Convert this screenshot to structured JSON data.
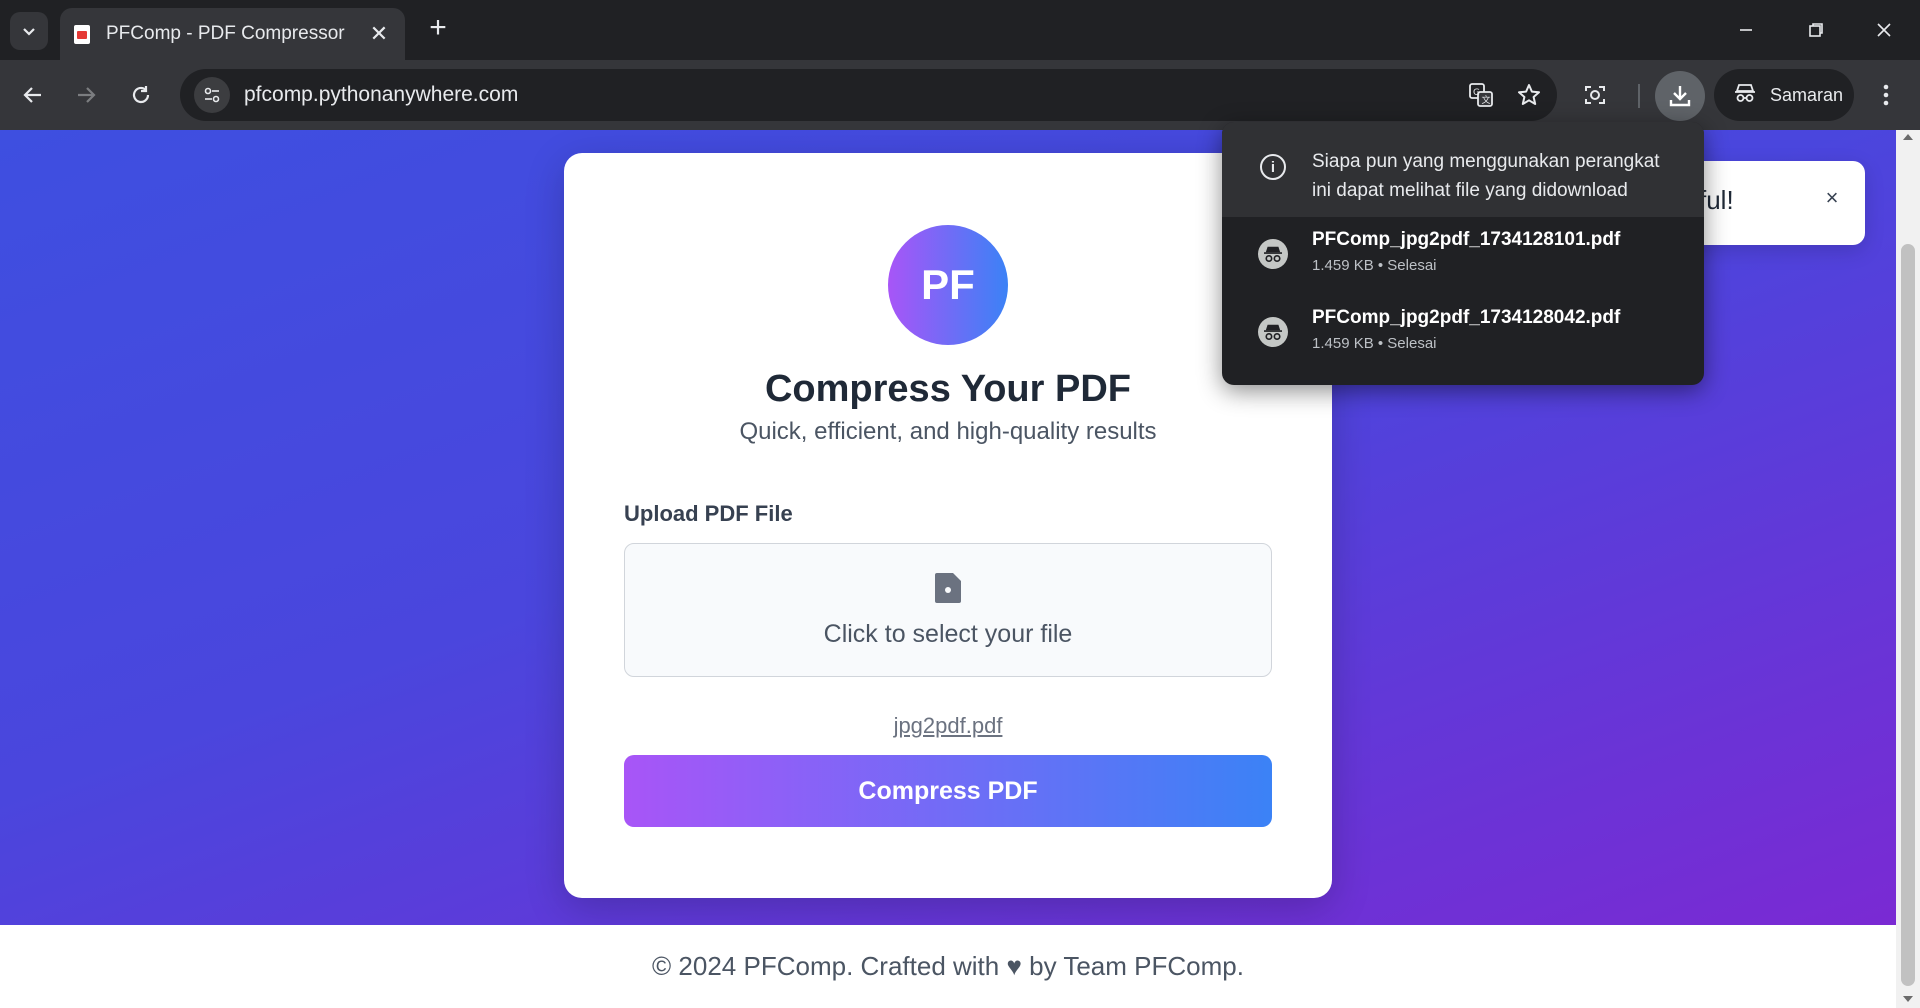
{
  "browser": {
    "tab_title": "PFComp - PDF Compressor",
    "new_tab_symbol": "+",
    "url": "pfcomp.pythonanywhere.com",
    "profile_label": "Samaran"
  },
  "downloads": {
    "notice": "Siapa pun yang menggunakan perangkat ini dapat melihat file yang didownload",
    "items": [
      {
        "name": "PFComp_jpg2pdf_1734128101.pdf",
        "meta": "1.459 KB • Selesai"
      },
      {
        "name": "PFComp_jpg2pdf_1734128042.pdf",
        "meta": "1.459 KB • Selesai"
      }
    ]
  },
  "page": {
    "logo_text": "PF",
    "title": "Compress Your PDF",
    "subtitle": "Quick, efficient, and high-quality results",
    "upload_label": "Upload PDF File",
    "dropzone_text": "Click to select your file",
    "selected_file": "jpg2pdf.pdf",
    "submit_label": "Compress PDF",
    "toast_text": "sful!",
    "toast_close": "×",
    "footer": "© 2024 PFComp. Crafted with ♥ by Team PFComp."
  },
  "colors": {
    "gradient_start": "#a855f7",
    "gradient_end": "#3b82f6",
    "hero_start": "#3e4fe0",
    "hero_end": "#7a2ad3"
  },
  "icons": {
    "tab_search": "chevron-down-icon",
    "favicon": "pdf-icon",
    "back": "arrow-left-icon",
    "forward": "arrow-right-icon",
    "reload": "reload-icon",
    "site_info": "tune-icon",
    "translate": "translate-icon",
    "bookmark": "star-icon",
    "lens": "screenshot-icon",
    "download": "download-icon",
    "incognito": "incognito-icon",
    "menu": "kebab-menu-icon",
    "info": "info-icon",
    "file": "file-icon"
  }
}
